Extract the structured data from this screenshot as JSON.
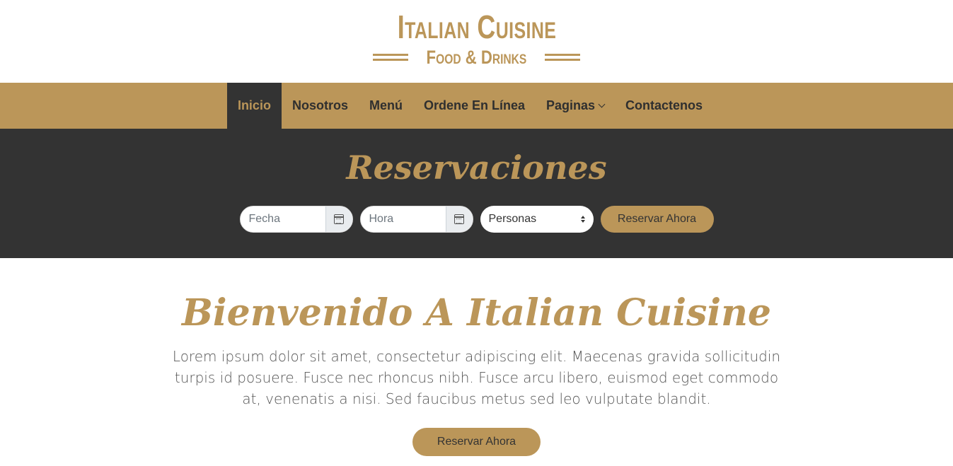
{
  "logo": {
    "title": "Italian Cuisine",
    "subtitle": "Food & Drinks"
  },
  "nav": {
    "items": [
      "Inicio",
      "Nosotros",
      "Menú",
      "Ordene En Línea",
      "Paginas",
      "Contactenos"
    ],
    "active": "Inicio"
  },
  "reservation": {
    "title": "Reservaciones",
    "date_placeholder": "Fecha",
    "time_placeholder": "Hora",
    "people_select": "Personas",
    "button": "Reservar Ahora"
  },
  "welcome": {
    "title": "Bienvenido A Italian Cuisine",
    "text": "Lorem ipsum dolor sit amet, consectetur adipiscing elit. Maecenas gravida sollicitudin turpis id posuere. Fusce nec rhoncus nibh. Fusce arcu libero, euismod eget commodo at, venenatis a nisi. Sed faucibus metus sed leo vulputate blandit.",
    "button": "Reservar Ahora"
  },
  "colors": {
    "accent": "#bb9659",
    "dark": "#333333",
    "white": "#ffffff"
  },
  "icons": [
    "calendar-icon",
    "chevron-down-icon",
    "select-arrows-icon"
  ]
}
